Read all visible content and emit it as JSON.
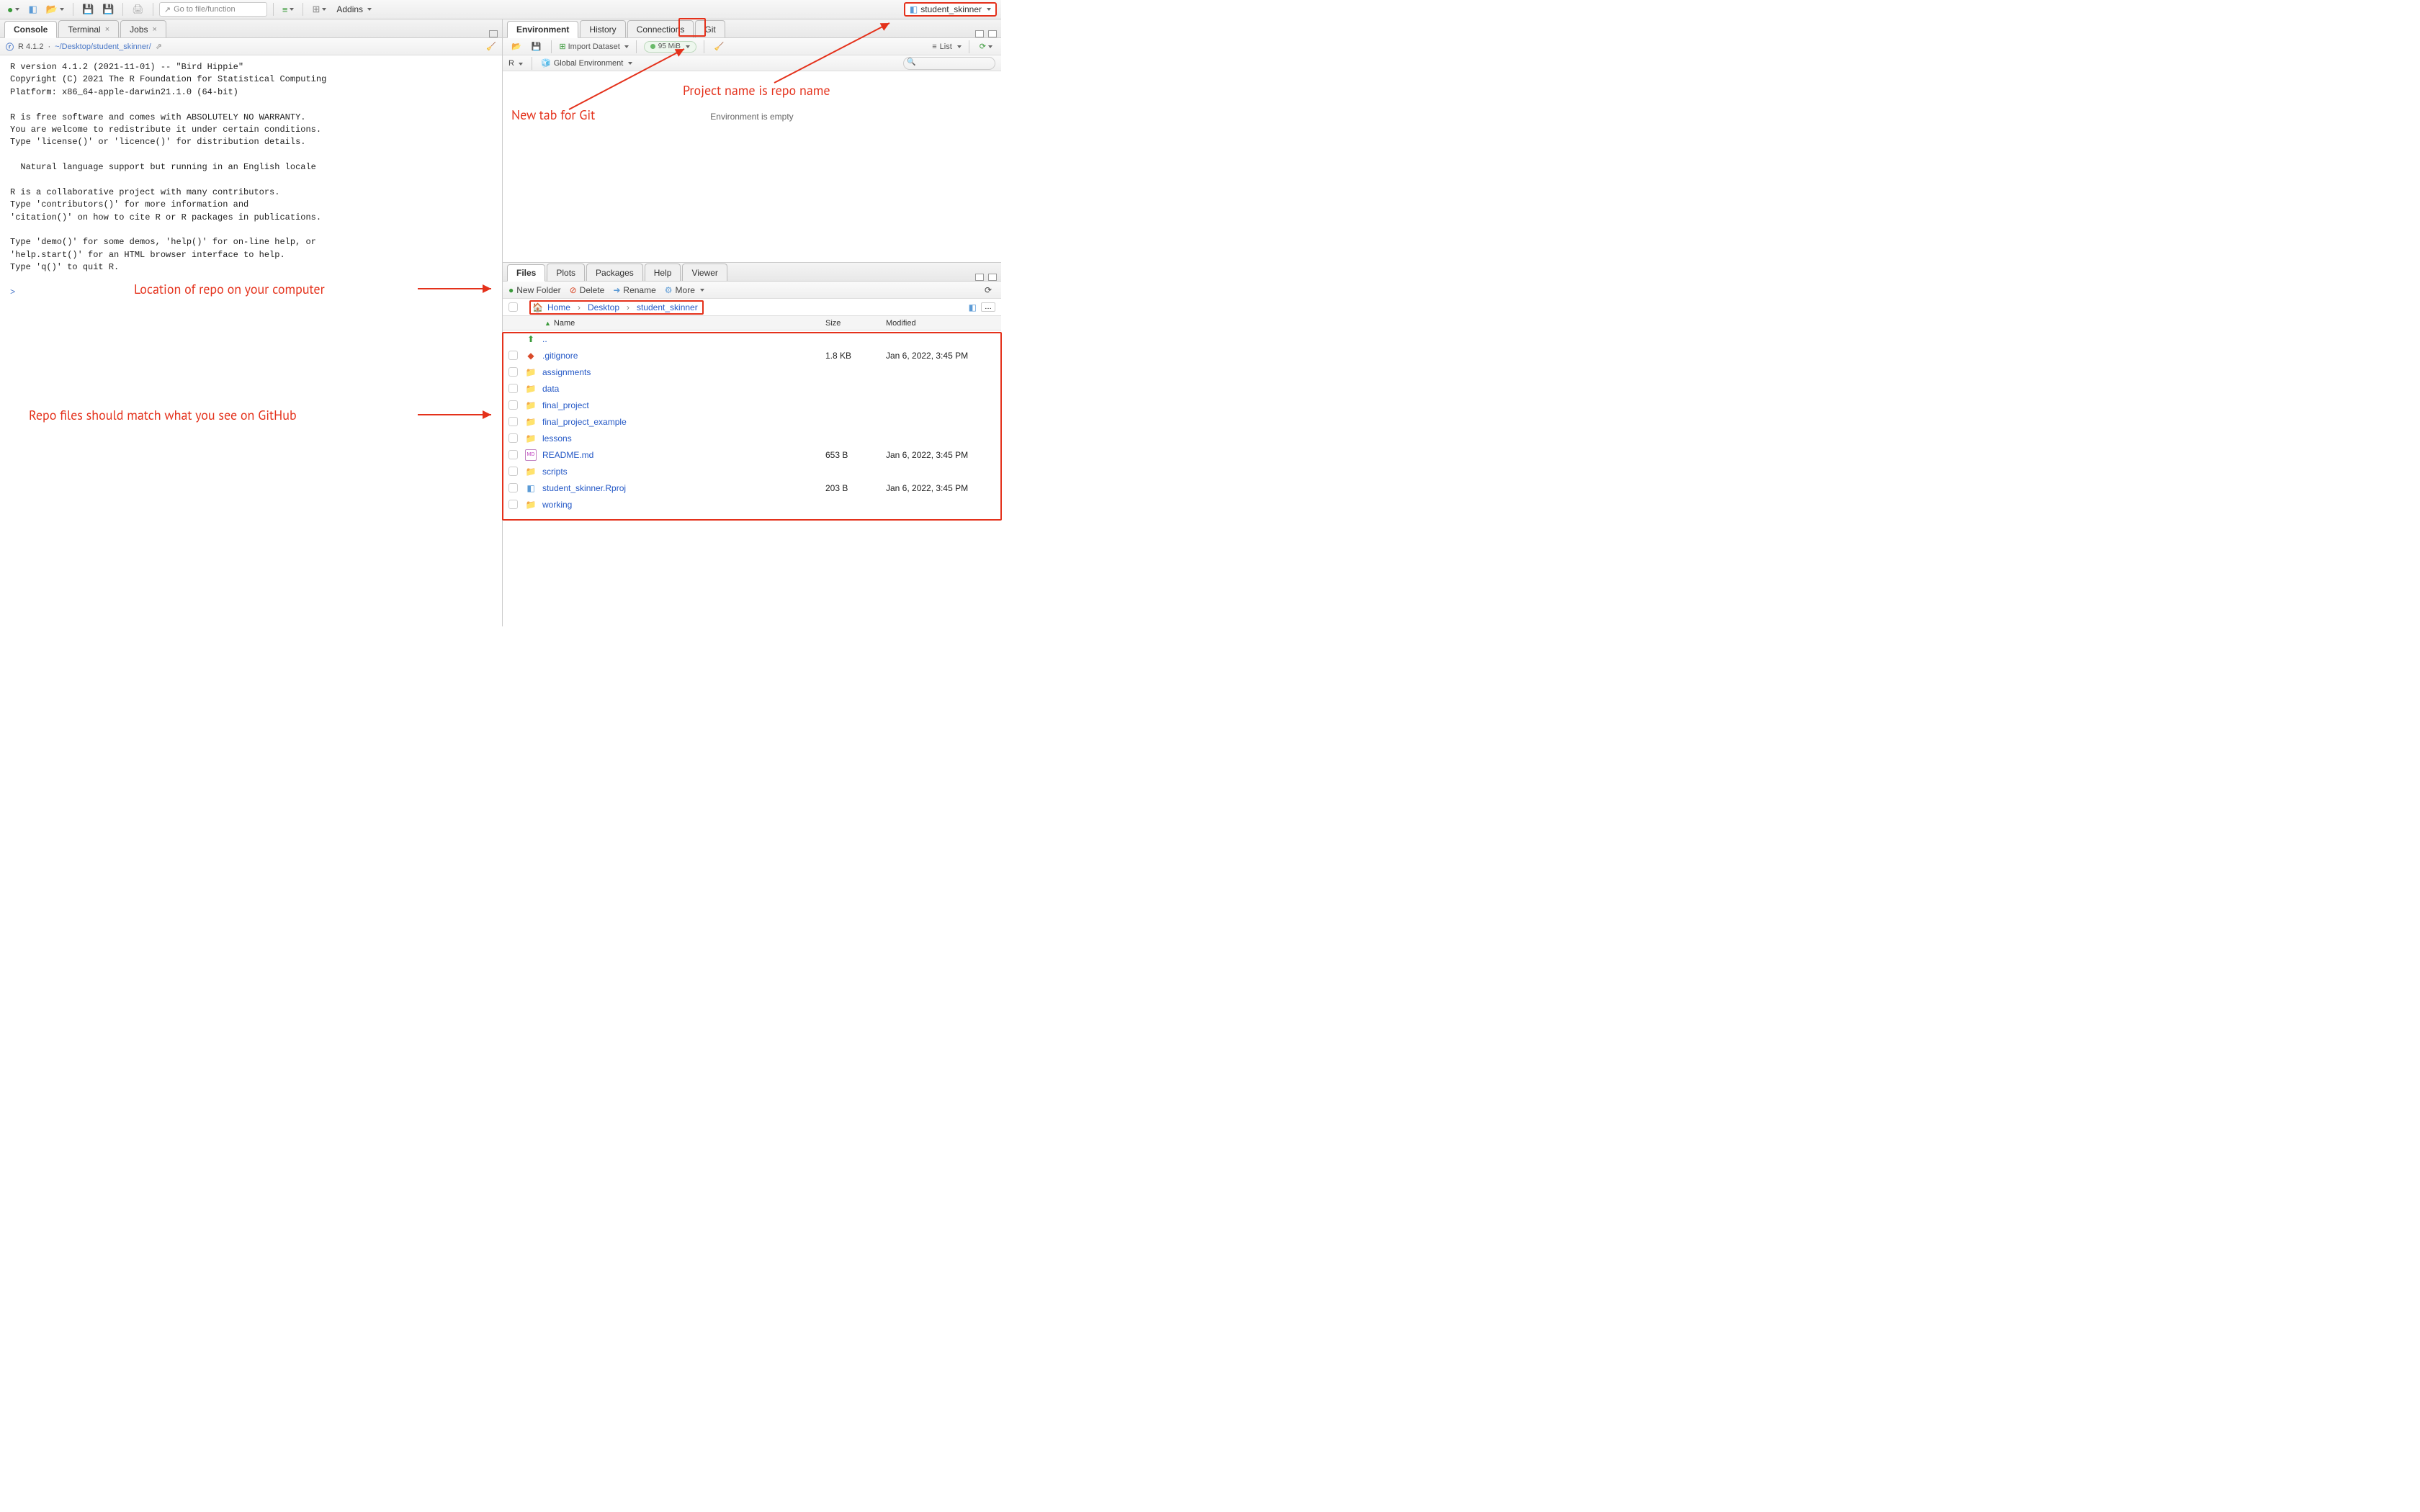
{
  "toolbar": {
    "goto_placeholder": "Go to file/function",
    "addins_label": "Addins",
    "project_name": "student_skinner"
  },
  "left": {
    "tabs": {
      "console": "Console",
      "terminal": "Terminal",
      "jobs": "Jobs"
    },
    "secbar": {
      "r_version": "R 4.1.2",
      "path": "~/Desktop/student_skinner/"
    },
    "console_text": "R version 4.1.2 (2021-11-01) -- \"Bird Hippie\"\nCopyright (C) 2021 The R Foundation for Statistical Computing\nPlatform: x86_64-apple-darwin21.1.0 (64-bit)\n\nR is free software and comes with ABSOLUTELY NO WARRANTY.\nYou are welcome to redistribute it under certain conditions.\nType 'license()' or 'licence()' for distribution details.\n\n  Natural language support but running in an English locale\n\nR is a collaborative project with many contributors.\nType 'contributors()' for more information and\n'citation()' on how to cite R or R packages in publications.\n\nType 'demo()' for some demos, 'help()' for on-line help, or\n'help.start()' for an HTML browser interface to help.\nType 'q()' to quit R.\n",
    "prompt": ">"
  },
  "env": {
    "tabs": {
      "environment": "Environment",
      "history": "History",
      "connections": "Connections",
      "git": "Git"
    },
    "secbar": {
      "import": "Import Dataset",
      "mem": "95 MiB",
      "list": "List"
    },
    "thirdbar": {
      "r": "R",
      "scope": "Global Environment"
    },
    "empty_msg": "Environment is empty"
  },
  "files_pane": {
    "tabs": {
      "files": "Files",
      "plots": "Plots",
      "packages": "Packages",
      "help": "Help",
      "viewer": "Viewer"
    },
    "toolbar": {
      "new_folder": "New Folder",
      "delete": "Delete",
      "rename": "Rename",
      "more": "More"
    },
    "breadcrumb": [
      "Home",
      "Desktop",
      "student_skinner"
    ],
    "headers": {
      "name": "Name",
      "size": "Size",
      "modified": "Modified"
    },
    "rows": [
      {
        "icon": "up",
        "name": "..",
        "size": "",
        "mod": ""
      },
      {
        "icon": "gitignore",
        "name": ".gitignore",
        "size": "1.8 KB",
        "mod": "Jan 6, 2022, 3:45 PM"
      },
      {
        "icon": "folder",
        "name": "assignments",
        "size": "",
        "mod": ""
      },
      {
        "icon": "folder",
        "name": "data",
        "size": "",
        "mod": ""
      },
      {
        "icon": "folder",
        "name": "final_project",
        "size": "",
        "mod": ""
      },
      {
        "icon": "folder",
        "name": "final_project_example",
        "size": "",
        "mod": ""
      },
      {
        "icon": "folder",
        "name": "lessons",
        "size": "",
        "mod": ""
      },
      {
        "icon": "md",
        "name": "README.md",
        "size": "653 B",
        "mod": "Jan 6, 2022, 3:45 PM"
      },
      {
        "icon": "folder",
        "name": "scripts",
        "size": "",
        "mod": ""
      },
      {
        "icon": "rproj",
        "name": "student_skinner.Rproj",
        "size": "203 B",
        "mod": "Jan 6, 2022, 3:45 PM"
      },
      {
        "icon": "folder",
        "name": "working",
        "size": "",
        "mod": ""
      }
    ]
  },
  "annotations": {
    "git_tab": "New tab for Git",
    "project": "Project name is repo name",
    "repo_loc": "Location of repo on your computer",
    "repo_files": "Repo files should match what you see on GitHub"
  }
}
